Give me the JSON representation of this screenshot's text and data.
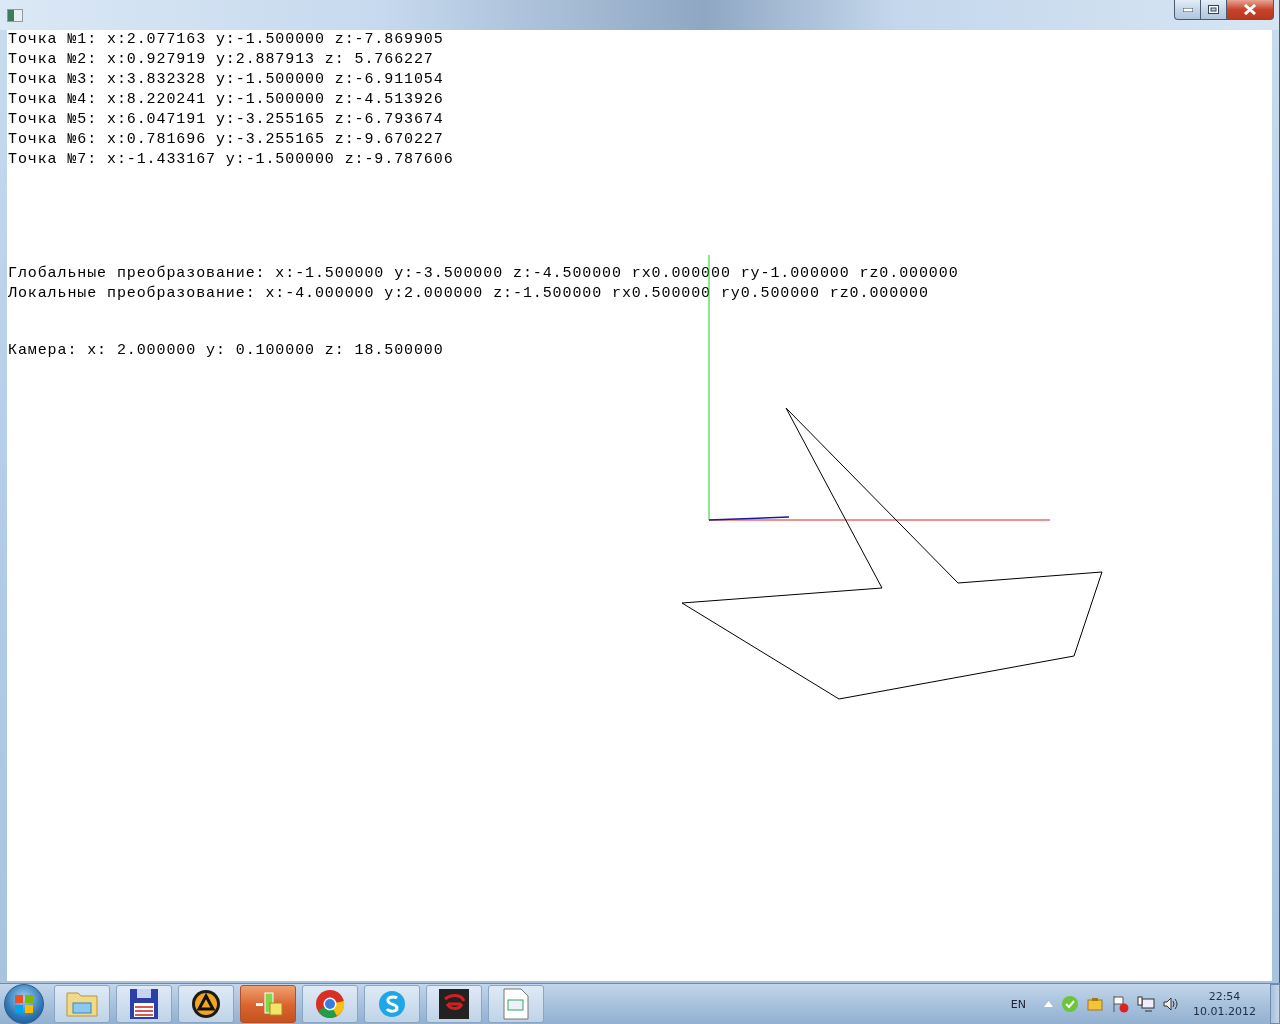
{
  "points": [
    "Точка №1: x:2.077163 y:-1.500000 z:-7.869905",
    "Точка №2: x:0.927919 y:2.887913 z: 5.766227",
    "Точка №3: x:3.832328 y:-1.500000 z:-6.911054",
    "Точка №4: x:8.220241 y:-1.500000 z:-4.513926",
    "Точка №5: x:6.047191 y:-3.255165 z:-6.793674",
    "Точка №6: x:0.781696 y:-3.255165 z:-9.670227",
    "Точка №7: x:-1.433167 y:-1.500000 z:-9.787606"
  ],
  "transforms": [
    "Глобальные преобразование: x:-1.500000 y:-3.500000 z:-4.500000 rx0.000000 ry-1.000000 rz0.000000",
    "Локальные преобразование: x:-4.000000 y:2.000000 z:-1.500000 rx0.500000 ry0.500000 rz0.000000"
  ],
  "camera": "Камера: x: 2.000000 y: 0.100000 z: 18.500000",
  "taskbar": {
    "buttons": [
      {
        "kind": "folder",
        "selected": false
      },
      {
        "kind": "floppy",
        "selected": false
      },
      {
        "kind": "player",
        "selected": false
      },
      {
        "kind": "app",
        "selected": true
      },
      {
        "kind": "browser",
        "selected": false
      },
      {
        "kind": "chat",
        "selected": false
      },
      {
        "kind": "game",
        "selected": false
      },
      {
        "kind": "document",
        "selected": false
      }
    ],
    "language": "EN",
    "time": "22:54",
    "date": "10.01.2012"
  }
}
